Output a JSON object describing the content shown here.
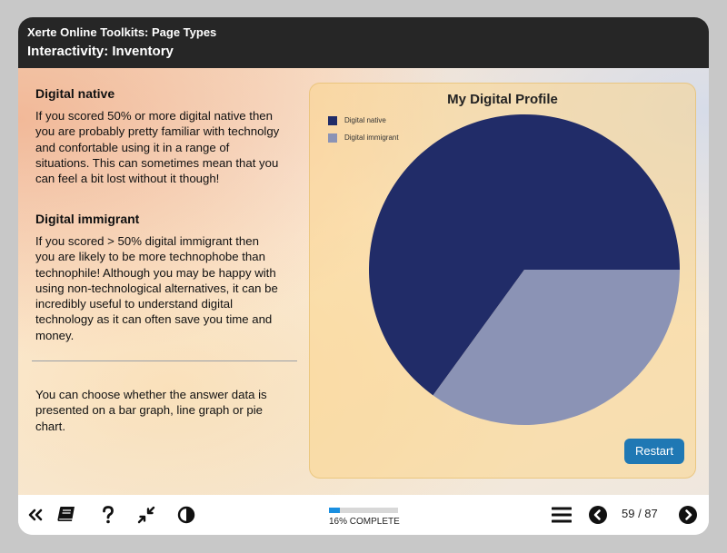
{
  "header": {
    "app_title": "Xerte Online Toolkits: Page Types",
    "page_title": "Interactivity: Inventory"
  },
  "sections": [
    {
      "heading": "Digital native",
      "lines": [
        "If you scored 50% or more digital native then",
        "you are probably pretty familiar with technolgy",
        "and confortable using it in a range of",
        "situations. This can sometimes mean that you",
        "can feel a bit lost without it though!"
      ]
    },
    {
      "heading": "Digital immigrant",
      "lines": [
        "If you scored > 50% digital immigrant then",
        "you are likely to be more technophobe than",
        "technophile! Although you may be happy with",
        "using non-technological alternatives, it can be",
        "incredibly useful to understand digital",
        "technology as it can often save you time and",
        "money."
      ]
    }
  ],
  "note_lines": [
    "You can choose whether the answer data is",
    "presented on a bar graph, line graph or pie",
    "chart."
  ],
  "chart_data": {
    "type": "pie",
    "title": "My Digital Profile",
    "labels": [
      "Digital native",
      "Digital immigrant"
    ],
    "values": [
      65,
      35
    ],
    "colors": [
      "#212c68",
      "#8b93b5"
    ],
    "legend_position": "top-left",
    "start": "3 o'clock, counter-clockwise"
  },
  "restart_label": "Restart",
  "footer": {
    "progress_percent": 16,
    "progress_label": "16% COMPLETE",
    "page_counter": "59 / 87",
    "icons": {
      "back": "double-chevron-left-icon",
      "glossary": "book-icon",
      "help": "question-icon",
      "minimise": "shrink-arrows-icon",
      "contrast": "contrast-icon",
      "menu": "hamburger-icon",
      "prev": "circle-chevron-left-icon",
      "next": "circle-chevron-right-icon"
    }
  }
}
